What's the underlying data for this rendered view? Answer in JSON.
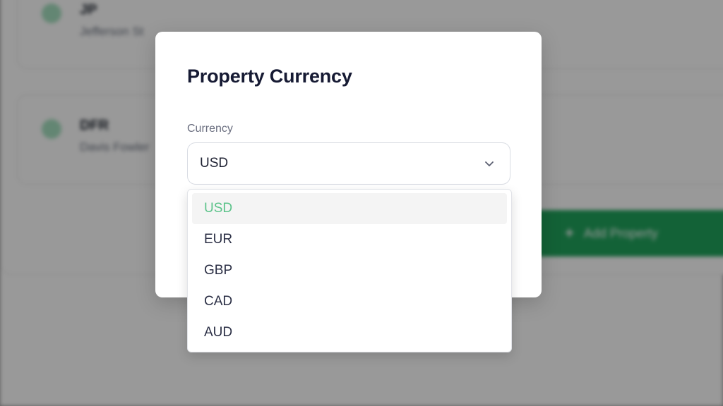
{
  "background": {
    "cards": [
      {
        "title": "JP",
        "subtitle": "Jefferson St"
      },
      {
        "title": "DFR",
        "subtitle": "Davis Fowler"
      }
    ],
    "add_button_label": "Add Property"
  },
  "modal": {
    "title": "Property Currency",
    "field_label": "Currency",
    "selected_value": "USD"
  },
  "dropdown": {
    "options": [
      {
        "label": "USD",
        "selected": true
      },
      {
        "label": "EUR",
        "selected": false
      },
      {
        "label": "GBP",
        "selected": false
      },
      {
        "label": "CAD",
        "selected": false
      },
      {
        "label": "AUD",
        "selected": false
      }
    ]
  },
  "colors": {
    "accent": "#5cc38a",
    "brand_green": "#21a45d",
    "title": "#161a33"
  },
  "icons": {
    "select_toggle": "chevron-down-icon",
    "add": "plus-icon"
  }
}
